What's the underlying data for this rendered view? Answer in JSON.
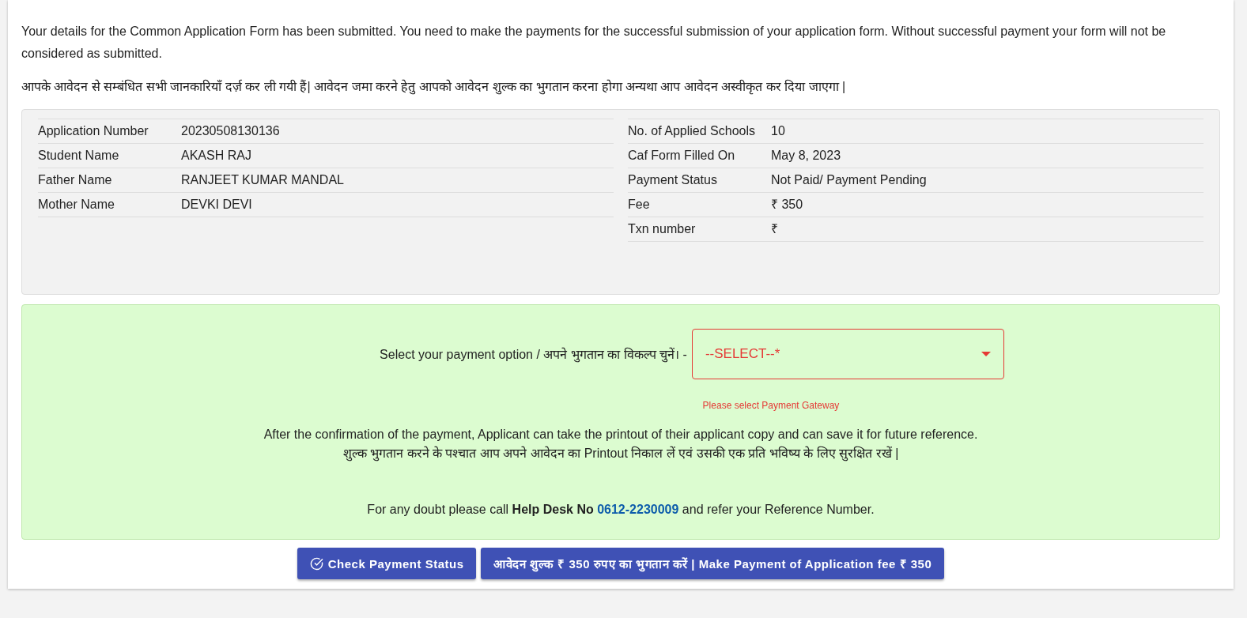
{
  "notice_en": "Your details for the Common Application Form has been submitted. You need to make the payments for the successful submission of your application form. Without successful payment your form will not be considered as submitted.",
  "notice_hi": "आपके आवेदन से सम्बंधित सभी जानकारियाँ दर्ज़ कर ली गयी हैं| आवेदन जमा करने हेतु आपको आवेदन शुल्क का भुगतान करना होगा अन्यथा आप आवेदन अस्वीकृत कर दिया जाएगा |",
  "details_left": [
    {
      "label": "Application Number",
      "value": "20230508130136"
    },
    {
      "label": "Student Name",
      "value": "AKASH RAJ"
    },
    {
      "label": "Father Name",
      "value": "RANJEET KUMAR MANDAL"
    },
    {
      "label": "Mother Name",
      "value": "DEVKI DEVI"
    }
  ],
  "details_right": [
    {
      "label": "No. of Applied Schools",
      "value": "10"
    },
    {
      "label": "Caf Form Filled On",
      "value": "May 8, 2023"
    },
    {
      "label": "Payment Status",
      "value": "Not Paid/ Payment Pending"
    },
    {
      "label": "Fee",
      "value": "₹ 350"
    },
    {
      "label": "Txn number",
      "value": "₹"
    }
  ],
  "payment": {
    "label": "Select your payment option / अपने भुगतान का विकल्प चुनें। -",
    "select_value": "--SELECT--*",
    "invalid": true,
    "error": "Please select Payment Gateway",
    "info_en": "After the confirmation of the payment, Applicant can take the printout of their applicant copy and can save it for future reference.",
    "info_hi": "शुल्क भुगतान करने के पश्चात आप अपने आवेदन का Printout निकाल लें एवं उसकी एक प्रति भविष्य के लिए सुरक्षित रखें |",
    "help_prefix": "For any doubt please call **Help Desk No**",
    "help_phone": "0612-2230009",
    "help_suffix": "and refer your Reference Number."
  },
  "buttons": [
    {
      "kind": "icon",
      "label": "Check Payment Status"
    },
    {
      "kind": "plain",
      "label": "आवेदन शुल्क ₹ 350 रुपए का भुगतान करें | Make Payment of Application fee ₹ 350"
    }
  ]
}
